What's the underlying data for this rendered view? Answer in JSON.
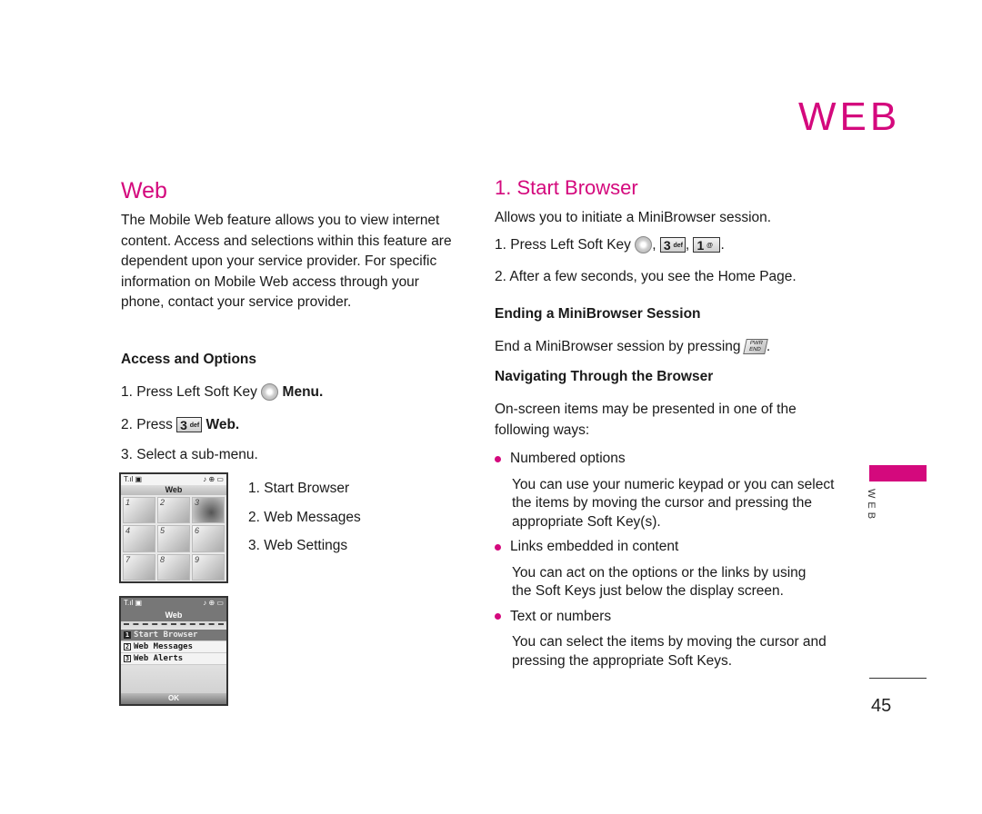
{
  "chapter_title": "WEB",
  "left": {
    "heading": "Web",
    "intro": "The Mobile Web feature allows you to view internet content. Access and selections within this feature are dependent upon your service provider. For specific information on Mobile Web access through your phone, contact your service provider.",
    "access_heading": "Access and Options",
    "steps": [
      {
        "prefix": "1. Press Left Soft Key",
        "key": "soft-key",
        "suffix": "Menu."
      },
      {
        "prefix": "2. Press",
        "key": "3 def",
        "suffix": "Web."
      },
      {
        "prefix": "3. Select a sub-menu.",
        "key": "",
        "suffix": ""
      }
    ],
    "submenu": [
      "1. Start Browser",
      "2. Web Messages",
      "3. Web Settings"
    ],
    "phone1": {
      "status_icons": [
        "signal-icon",
        "message-icon",
        "music-icon",
        "gps-icon",
        "battery-icon"
      ],
      "title": "Web",
      "grid_numbers": [
        "1",
        "2",
        "3",
        "4",
        "5",
        "6",
        "7",
        "8",
        "9"
      ],
      "selected_index": 2
    },
    "phone2": {
      "title": "Web",
      "items": [
        {
          "num": "1",
          "label": "Start Browser"
        },
        {
          "num": "2",
          "label": "Web Messages"
        },
        {
          "num": "3",
          "label": "Web Alerts"
        }
      ],
      "selected_index": 0,
      "softkey": "OK"
    }
  },
  "right": {
    "heading": "1. Start Browser",
    "intro": "Allows you to initiate a MiniBrowser session.",
    "step1_prefix": "1. Press Left Soft Key",
    "step1_keys": [
      "soft-key",
      "3 def",
      "1"
    ],
    "step2": "2. After a few seconds, you see the Home Page.",
    "ending_heading": "Ending a MiniBrowser Session",
    "ending_text": "End a MiniBrowser session by pressing",
    "end_key_label": "PWR END",
    "nav_heading": "Navigating Through the Browser",
    "nav_intro": "On-screen items may be presented in one of the following ways:",
    "bullets": [
      {
        "title": "Numbered options",
        "text": "You can use your numeric keypad or you can select the items by moving the cursor and pressing the appropriate Soft Key(s)."
      },
      {
        "title": "Links embedded in content",
        "text": "You can act on the options or the links by using the Soft Keys just below the display screen."
      },
      {
        "title": "Text or numbers",
        "text": "You can select the items by moving the cursor and pressing the appropriate Soft Keys."
      }
    ]
  },
  "side_tab_label": "WEB",
  "page_number": "45",
  "colors": {
    "accent": "#d4097d"
  }
}
